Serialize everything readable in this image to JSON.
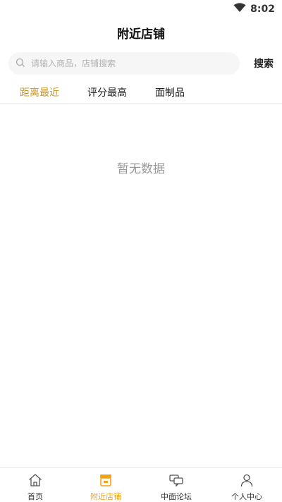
{
  "status_bar": {
    "time": "8:02",
    "wifi_icon": "wifi-icon"
  },
  "header": {
    "title": "附近店铺"
  },
  "search": {
    "placeholder": "请输入商品，店铺搜索",
    "value": "",
    "button_label": "搜索",
    "icon": "search-icon"
  },
  "sort_tabs": [
    {
      "label": "距离最近",
      "active": true
    },
    {
      "label": "评分最高",
      "active": false
    },
    {
      "label": "面制品",
      "active": false
    }
  ],
  "empty_state": {
    "message": "暂无数据"
  },
  "tab_bar": {
    "items": [
      {
        "label": "首页",
        "icon": "home-icon",
        "active": false
      },
      {
        "label": "附近店铺",
        "icon": "store-icon",
        "active": true
      },
      {
        "label": "中面论坛",
        "icon": "forum-icon",
        "active": false
      },
      {
        "label": "个人中心",
        "icon": "user-icon",
        "active": false
      }
    ]
  },
  "colors": {
    "accent_tab": "#c8962f",
    "accent_bottom": "#f1a21a",
    "muted": "#999999"
  }
}
